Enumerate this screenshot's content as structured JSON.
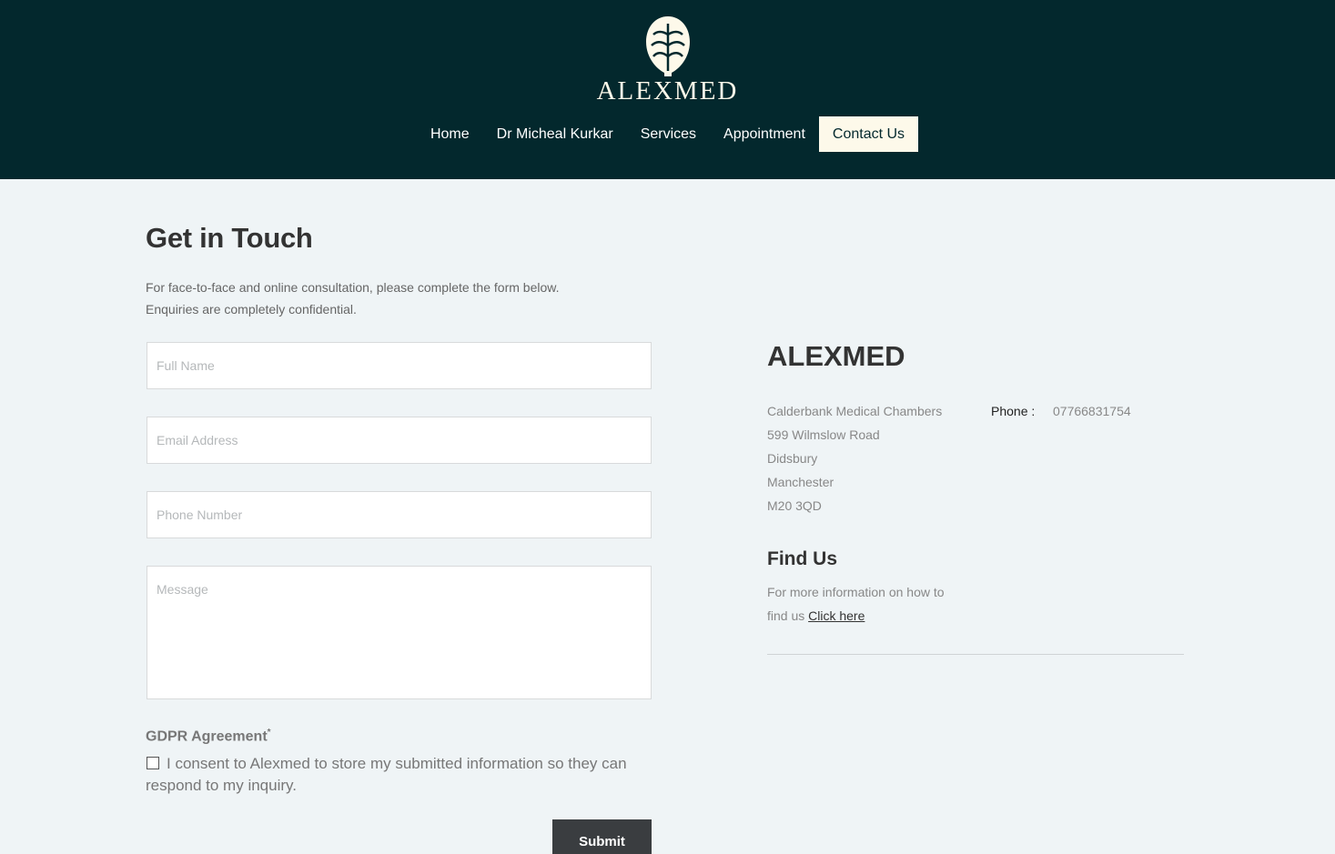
{
  "brand": {
    "name": "ALEXMED",
    "logo_icon": "leaf-tree-icon"
  },
  "nav": {
    "items": [
      {
        "label": "Home"
      },
      {
        "label": "Dr Micheal Kurkar"
      },
      {
        "label": "Services"
      },
      {
        "label": "Appointment"
      },
      {
        "label": "Contact Us"
      }
    ],
    "active": "Contact Us"
  },
  "form": {
    "title": "Get in Touch",
    "intro_line1": "For face-to-face and online consultation, please complete the form below.",
    "intro_line2": "Enquiries are completely confidential.",
    "full_name": {
      "placeholder": "Full Name",
      "value": ""
    },
    "email": {
      "placeholder": "Email Address",
      "value": ""
    },
    "phone": {
      "placeholder": "Phone Number",
      "value": ""
    },
    "message": {
      "placeholder": "Message",
      "value": ""
    },
    "gdpr_label": "GDPR Agreement",
    "gdpr_required_mark": "*",
    "gdpr_consent": "I consent to Alexmed to store my submitted information so they can respond to my inquiry.",
    "gdpr_checked": false,
    "submit_label": "Submit"
  },
  "contact": {
    "title": "ALEXMED",
    "address": [
      "Calderbank Medical Chambers",
      "599 Wilmslow Road",
      "Didsbury",
      "Manchester",
      "M20 3QD"
    ],
    "phone_label": "Phone :",
    "phone_value": "07766831754",
    "find_title": "Find Us",
    "find_text": "For more information on how to find us",
    "find_link": "Click here"
  },
  "colors": {
    "header_bg": "#03282d",
    "active_nav_bg": "#fdf9ea",
    "page_bg": "#eff4f6",
    "submit_bg": "#3a3d40"
  }
}
